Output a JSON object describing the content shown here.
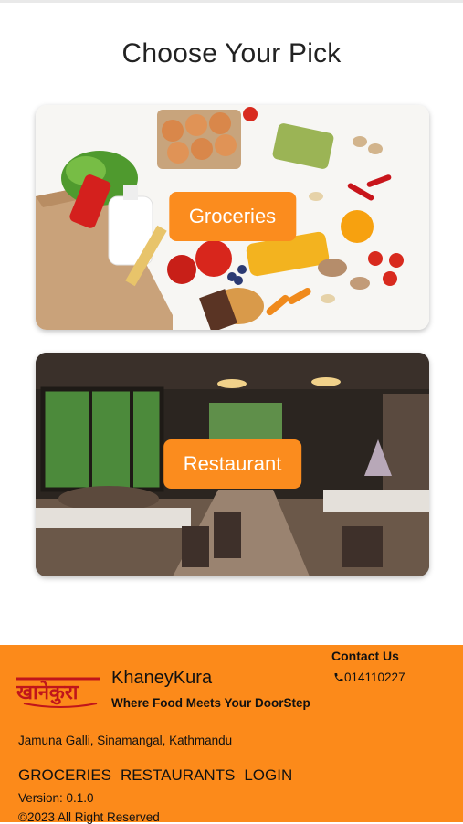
{
  "page": {
    "title": "Choose Your Pick"
  },
  "cards": [
    {
      "label": "Groceries"
    },
    {
      "label": "Restaurant"
    }
  ],
  "footer": {
    "logo_text": "खानेकुरा",
    "brand_name": "KhaneyKura",
    "tagline": "Where Food Meets Your DoorStep",
    "contact_heading": "Contact Us",
    "phone": "014110227",
    "address": "Jamuna Galli, Sinamangal, Kathmandu",
    "nav": [
      "GROCERIES",
      "RESTAURANTS",
      "LOGIN"
    ],
    "version": "Version: 0.1.0",
    "copyright": "©2023 All Right Reserved"
  },
  "colors": {
    "accent": "#fb8c1e",
    "footer_bg": "#fc8a1a"
  },
  "icons": {
    "phone": "phone-icon"
  }
}
